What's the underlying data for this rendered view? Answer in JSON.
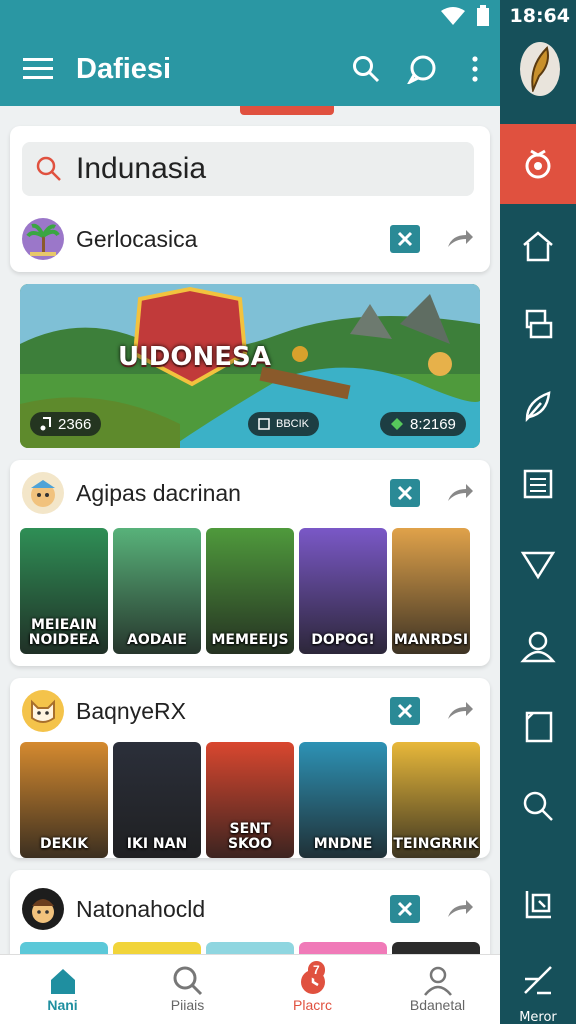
{
  "status": {
    "time": "18:64"
  },
  "app": {
    "title": "Dafiesi"
  },
  "search": {
    "value": "Indunasia"
  },
  "sections": [
    {
      "title": "Gerlocasica"
    },
    {
      "title": "Agipas dacrinan"
    },
    {
      "title": "BaqnyeRX"
    },
    {
      "title": "Natonahocld"
    }
  ],
  "banner": {
    "logo_text": "UIDONESA",
    "stats": {
      "left": "2366",
      "middle": "BBCIK",
      "right": "8:2169"
    }
  },
  "row1_tiles": [
    {
      "caption": "MEIEAIN NOIDEEA",
      "bg": "#2f8f56"
    },
    {
      "caption": "AODAIE",
      "bg": "#58b27a"
    },
    {
      "caption": "MEMEEIJS",
      "bg": "#4f9a3c"
    },
    {
      "caption": "DOPOG!",
      "bg": "#7a58c7"
    },
    {
      "caption": "MANRDSI",
      "bg": "#e0a24a"
    }
  ],
  "row2_tiles": [
    {
      "caption": "DEKIK",
      "bg": "#d58a2f"
    },
    {
      "caption": "IKI NAN",
      "bg": "#2b2f3a"
    },
    {
      "caption": "SENT SKOO",
      "bg": "#d9472f"
    },
    {
      "caption": "MNDNE",
      "bg": "#2d92b5"
    },
    {
      "caption": "TEINGRRIK",
      "bg": "#e8b83a"
    }
  ],
  "bottom_nav": [
    {
      "label": "Nani"
    },
    {
      "label": "Piiais"
    },
    {
      "label": "Placrc",
      "badge": "7"
    },
    {
      "label": "Bdanetal"
    }
  ],
  "rail": {
    "bottom_label": "Meror"
  },
  "colors": {
    "teal": "#2a97a3",
    "dark_teal": "#16505a",
    "accent_red": "#e0513f"
  }
}
